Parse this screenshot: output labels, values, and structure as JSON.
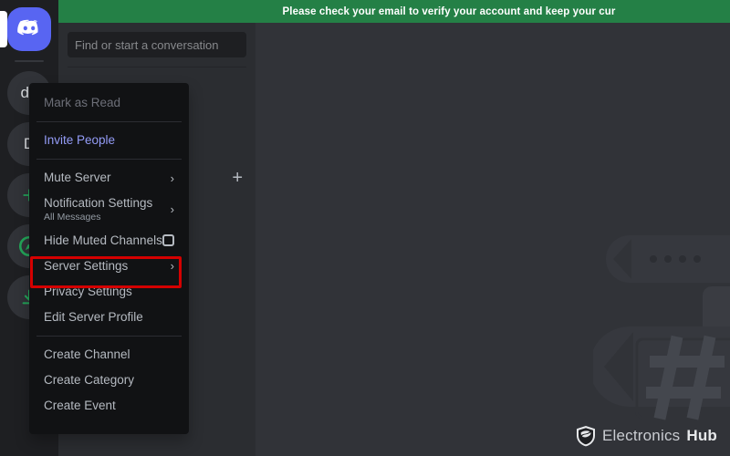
{
  "banner": {
    "text": "Please check your email to verify your account and keep your cur",
    "color": "#248046"
  },
  "server_rail": {
    "items": [
      {
        "name": "discord-home",
        "label": "",
        "icon": "discord-logo-icon",
        "type": "logo"
      },
      {
        "name": "server-de",
        "label": "de",
        "icon": "server-avatar-icon",
        "type": "avatar"
      },
      {
        "name": "server-d",
        "label": "D",
        "icon": "server-avatar-icon",
        "type": "avatar"
      },
      {
        "name": "add-server",
        "label": "+",
        "icon": "plus-icon",
        "type": "action"
      },
      {
        "name": "explore-servers",
        "label": "◎",
        "icon": "compass-icon",
        "type": "action"
      },
      {
        "name": "download-apps",
        "label": "↓",
        "icon": "download-icon",
        "type": "action"
      }
    ]
  },
  "sidebar": {
    "search_placeholder": "Find or start a conversation",
    "add_dm_label": "+"
  },
  "context_menu": {
    "items": [
      {
        "label": "Mark as Read",
        "name": "menu-item-mark-as-read",
        "state": "disabled",
        "trailing": "none",
        "sublabel": ""
      },
      {
        "label": "Invite People",
        "name": "menu-item-invite-people",
        "state": "brand",
        "trailing": "none",
        "sublabel": ""
      },
      {
        "label": "Mute Server",
        "name": "menu-item-mute-server",
        "state": "normal",
        "trailing": "chevron",
        "sublabel": ""
      },
      {
        "label": "Notification Settings",
        "name": "menu-item-notification-settings",
        "state": "normal",
        "trailing": "chevron",
        "sublabel": "All Messages"
      },
      {
        "label": "Hide Muted Channels",
        "name": "menu-item-hide-muted-channels",
        "state": "normal",
        "trailing": "checkbox",
        "sublabel": ""
      },
      {
        "label": "Server Settings",
        "name": "menu-item-server-settings",
        "state": "normal",
        "trailing": "chevron",
        "sublabel": ""
      },
      {
        "label": "Privacy Settings",
        "name": "menu-item-privacy-settings",
        "state": "normal",
        "trailing": "none",
        "sublabel": ""
      },
      {
        "label": "Edit Server Profile",
        "name": "menu-item-edit-server-profile",
        "state": "normal",
        "trailing": "none",
        "sublabel": ""
      },
      {
        "label": "Create Channel",
        "name": "menu-item-create-channel",
        "state": "normal",
        "trailing": "none",
        "sublabel": ""
      },
      {
        "label": "Create Category",
        "name": "menu-item-create-category",
        "state": "normal",
        "trailing": "none",
        "sublabel": ""
      },
      {
        "label": "Create Event",
        "name": "menu-item-create-event",
        "state": "normal",
        "trailing": "none",
        "sublabel": ""
      }
    ],
    "chevron_glyph": "›",
    "highlight_color": "#d40000",
    "highlighted_item": "Server Settings"
  },
  "watermark": {
    "brand_light": "Electronics",
    "brand_strong": "Hub"
  },
  "colors": {
    "rail_bg": "#1e1f22",
    "sidebar_bg": "#2b2d31",
    "main_bg": "#313338",
    "menu_bg": "#111214",
    "brand_blurple": "#5865f2",
    "link_blurple": "#949cf7",
    "banner_green": "#248046",
    "accent_green": "#23a559"
  }
}
